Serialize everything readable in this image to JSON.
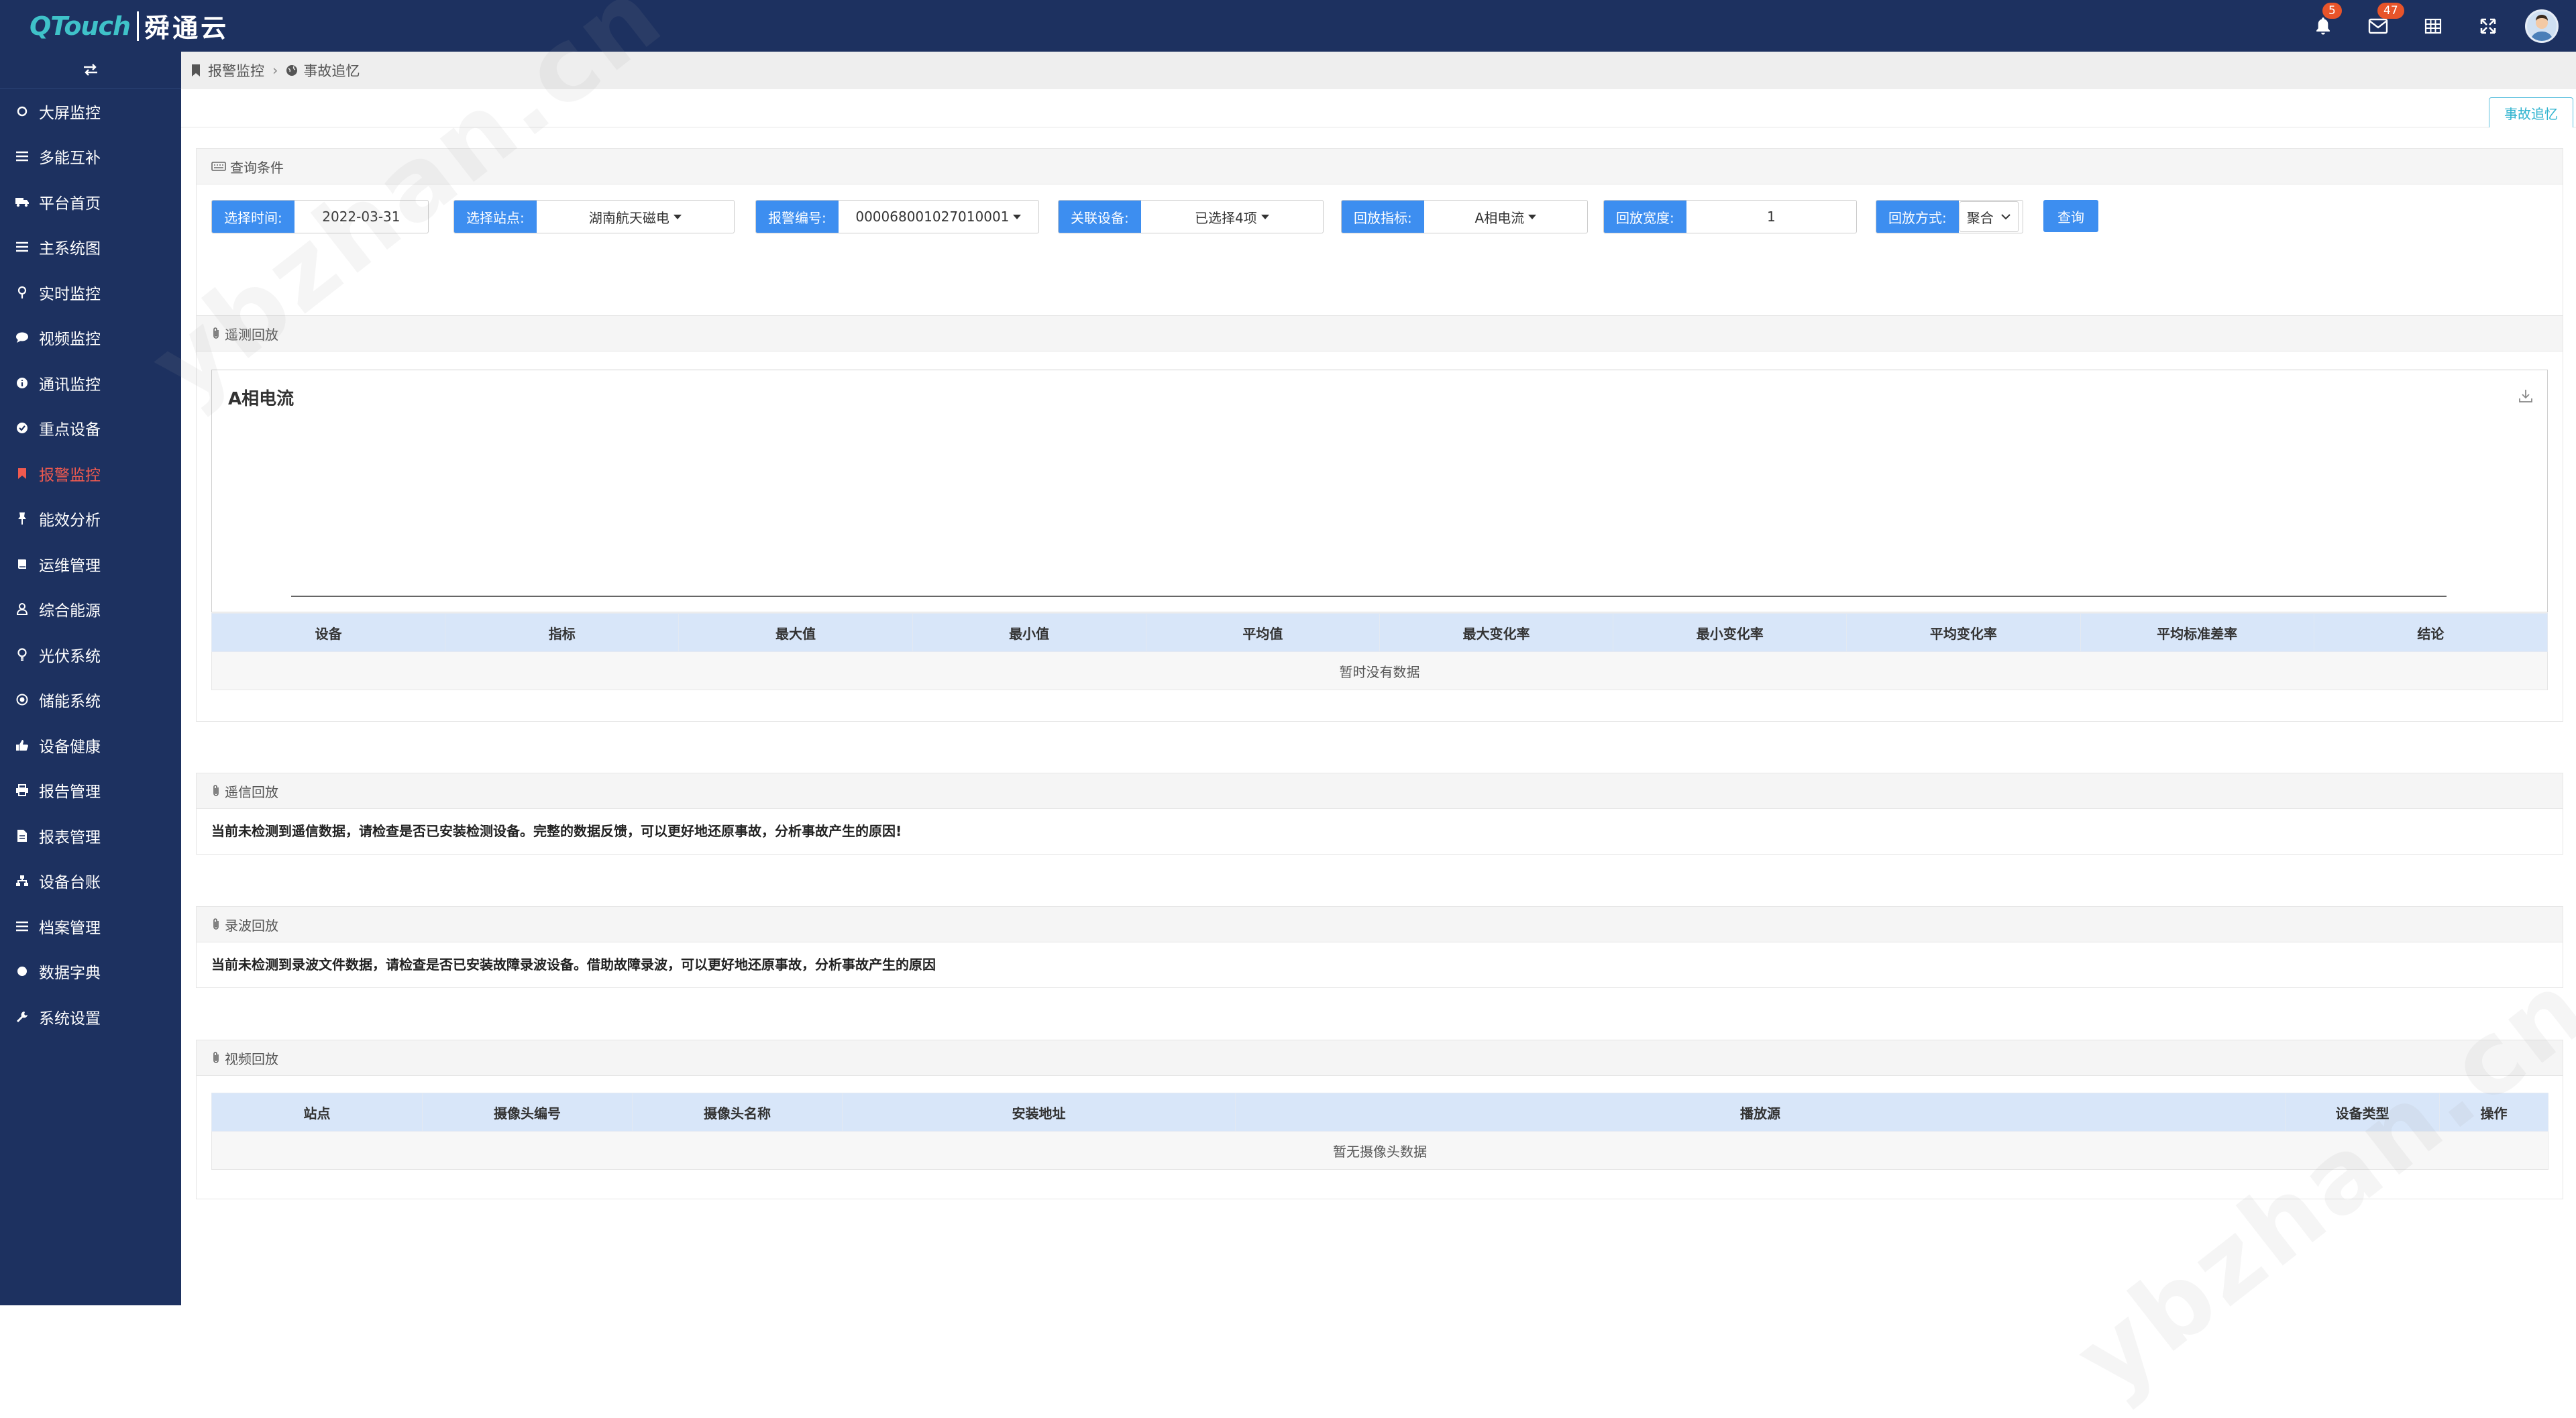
{
  "app": {
    "brand_en": "QTouch",
    "brand_cn": "舜通云",
    "notification_count": "5",
    "message_count": "47",
    "header_icons": [
      "bell-icon",
      "envelope-icon",
      "grid-icon",
      "fullscreen-icon",
      "user-avatar"
    ]
  },
  "sidebar": {
    "toggle_icon": "swap-icon",
    "items": [
      {
        "label": "大屏监控",
        "icon": "circle-icon"
      },
      {
        "label": "多能互补",
        "icon": "list-icon"
      },
      {
        "label": "平台首页",
        "icon": "truck-icon"
      },
      {
        "label": "主系统图",
        "icon": "list-icon"
      },
      {
        "label": "实时监控",
        "icon": "pin-icon"
      },
      {
        "label": "视频监控",
        "icon": "comment-icon"
      },
      {
        "label": "通讯监控",
        "icon": "info-icon"
      },
      {
        "label": "重点设备",
        "icon": "check-circle-icon"
      },
      {
        "label": "报警监控",
        "icon": "bookmark-icon"
      },
      {
        "label": "能效分析",
        "icon": "pushpin-icon"
      },
      {
        "label": "运维管理",
        "icon": "book-icon"
      },
      {
        "label": "综合能源",
        "icon": "user-icon"
      },
      {
        "label": "光伏系统",
        "icon": "bulb-icon"
      },
      {
        "label": "储能系统",
        "icon": "target-icon"
      },
      {
        "label": "设备健康",
        "icon": "thumbs-up-icon"
      },
      {
        "label": "报告管理",
        "icon": "print-icon"
      },
      {
        "label": "报表管理",
        "icon": "file-icon"
      },
      {
        "label": "设备台账",
        "icon": "sitemap-icon"
      },
      {
        "label": "档案管理",
        "icon": "list-icon"
      },
      {
        "label": "数据字典",
        "icon": "dot-icon"
      },
      {
        "label": "系统设置",
        "icon": "wrench-icon"
      }
    ],
    "active_index": 8,
    "active_color": "#f05a4f"
  },
  "breadcrumb": {
    "parent": "报警监控",
    "current": "事故追忆"
  },
  "tab": {
    "active_label": "事故追忆"
  },
  "query": {
    "title": "查询条件",
    "time_label": "选择时间:",
    "time_value": "2022-03-31",
    "station_label": "选择站点:",
    "station_value": "湖南航天磁电",
    "alarm_label": "报警编号:",
    "alarm_value": "000068001027010001",
    "device_label": "关联设备:",
    "device_value": "已选择4项",
    "metric_label": "回放指标:",
    "metric_value": "A相电流",
    "width_label": "回放宽度:",
    "width_value": "1",
    "mode_label": "回放方式:",
    "mode_value": "聚合",
    "submit_label": "查询"
  },
  "telemetry": {
    "title": "遥测回放",
    "table_headers": [
      "设备",
      "指标",
      "最大值",
      "最小值",
      "平均值",
      "最大变化率",
      "最小变化率",
      "平均变化率",
      "平均标准差率",
      "结论"
    ],
    "empty_text": "暂时没有数据"
  },
  "chart_data": {
    "type": "line",
    "title": "A相电流",
    "series": [],
    "download_icon": "download-icon"
  },
  "remote_signal": {
    "title": "遥信回放",
    "message": "当前未检测到遥信数据，请检查是否已安装检测设备。完整的数据反馈，可以更好地还原事故，分析事故产生的原因!"
  },
  "waveform": {
    "title": "录波回放",
    "message": "当前未检测到录波文件数据，请检查是否已安装故障录波设备。借助故障录波，可以更好地还原事故，分析事故产生的原因"
  },
  "video": {
    "title": "视频回放",
    "table_headers": [
      "站点",
      "摄像头编号",
      "摄像头名称",
      "安装地址",
      "播放源",
      "设备类型",
      "操作"
    ],
    "empty_text": "暂无摄像头数据"
  },
  "watermark": {
    "text": "ybzhan.cn"
  },
  "colors": {
    "header_bg": "#1d3160",
    "accent": "#3d8ef0",
    "table_head": "#d8e6f9"
  }
}
